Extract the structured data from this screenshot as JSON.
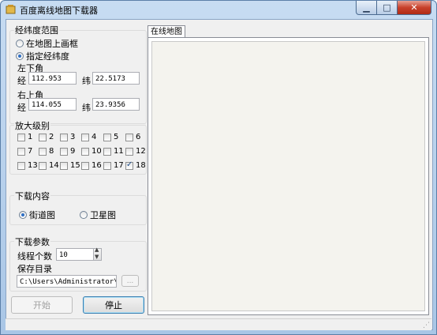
{
  "window": {
    "title": "百度离线地图下载器"
  },
  "range_group": {
    "legend": "经纬度范围",
    "options": [
      {
        "label": "在地图上画框",
        "selected": false
      },
      {
        "label": "指定经纬度",
        "selected": true
      }
    ],
    "lower_left": {
      "label": "左下角",
      "lng_label": "经",
      "lng": "112.953",
      "lat_label": "纬",
      "lat": "22.5173"
    },
    "upper_right": {
      "label": "右上角",
      "lng_label": "经",
      "lng": "114.055",
      "lat_label": "纬",
      "lat": "23.9356"
    }
  },
  "zoom_group": {
    "legend": "放大级别",
    "levels": [
      {
        "label": "1",
        "checked": false
      },
      {
        "label": "2",
        "checked": false
      },
      {
        "label": "3",
        "checked": false
      },
      {
        "label": "4",
        "checked": false
      },
      {
        "label": "5",
        "checked": false
      },
      {
        "label": "6",
        "checked": false
      },
      {
        "label": "7",
        "checked": false
      },
      {
        "label": "8",
        "checked": false
      },
      {
        "label": "9",
        "checked": false
      },
      {
        "label": "10",
        "checked": false
      },
      {
        "label": "11",
        "checked": false
      },
      {
        "label": "12",
        "checked": false
      },
      {
        "label": "13",
        "checked": false
      },
      {
        "label": "14",
        "checked": false
      },
      {
        "label": "15",
        "checked": false
      },
      {
        "label": "16",
        "checked": false
      },
      {
        "label": "17",
        "checked": false
      },
      {
        "label": "18",
        "checked": true
      }
    ]
  },
  "content_group": {
    "legend": "下载内容",
    "options": [
      {
        "label": "街道图",
        "selected": true
      },
      {
        "label": "卫星图",
        "selected": false
      }
    ]
  },
  "params_group": {
    "legend": "下载参数",
    "threads_label": "线程个数",
    "threads_value": "10",
    "dir_label": "保存目录",
    "dir_value": "C:\\Users\\Administrator\\Desktop",
    "browse_label": "..."
  },
  "buttons": {
    "start": "开始",
    "stop": "停止"
  },
  "tabs": [
    {
      "label": "在线地图"
    }
  ],
  "colors": {
    "accent": "#2e6fc4",
    "close_button": "#c8412c",
    "map_background": "#f4f3ee"
  }
}
